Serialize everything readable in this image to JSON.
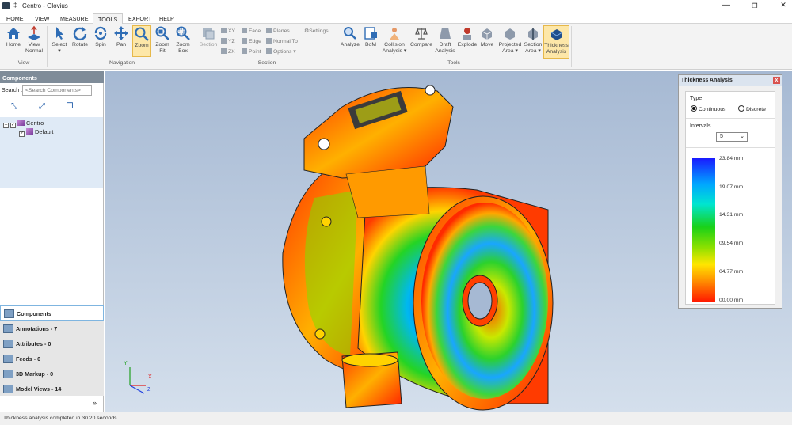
{
  "window": {
    "title": "Centro - Glovius",
    "pin": "‡",
    "min": "—",
    "max": "❐",
    "close": "✕"
  },
  "menu": {
    "tabs": [
      {
        "label": "HOME"
      },
      {
        "label": "VIEW"
      },
      {
        "label": "MEASURE"
      },
      {
        "label": "TOOLS"
      },
      {
        "label": "EXPORT"
      },
      {
        "label": "HELP"
      }
    ],
    "active": "TOOLS"
  },
  "ribbon": {
    "view": {
      "home": "Home",
      "view_normal_1": "View",
      "view_normal_2": "Normal",
      "group": "View"
    },
    "navigation": {
      "select": "Select",
      "rotate": "Rotate",
      "spin": "Spin",
      "pan": "Pan",
      "zoom": "Zoom",
      "zoom_fit_1": "Zoom",
      "zoom_fit_2": "Fit",
      "zoom_box_1": "Zoom",
      "zoom_box_2": "Box",
      "group": "Navigation"
    },
    "section": {
      "section": "Section",
      "xy": "XY",
      "yz": "YZ",
      "zx": "ZX",
      "face": "Face",
      "edge": "Edge",
      "point": "Point",
      "planes": "Planes",
      "normal_to": "Normal To",
      "options": "Options ▾",
      "settings": "Settings",
      "group": "Section"
    },
    "tools": {
      "analyze": "Analyze",
      "bom": "BoM",
      "collision_1": "Collision",
      "collision_2": "Analysis ▾",
      "compare": "Compare",
      "draft_1": "Draft",
      "draft_2": "Analysis",
      "explode": "Explode",
      "move": "Move",
      "projected_1": "Projected",
      "projected_2": "Area ▾",
      "section_area_1": "Section",
      "section_area_2": "Area ▾",
      "thickness_1": "Thickness",
      "thickness_2": "Analysis",
      "group": "Tools"
    }
  },
  "components_panel": {
    "header": "Components",
    "search_label": "Search :",
    "search_placeholder": "<Search Components>",
    "tree": [
      {
        "label": "Centro"
      },
      {
        "label": "Default"
      }
    ]
  },
  "bottom_tabs": [
    {
      "label": "Components"
    },
    {
      "label": "Annotations - 7"
    },
    {
      "label": "Attributes - 0"
    },
    {
      "label": "Feeds - 0"
    },
    {
      "label": "3D Markup - 0"
    },
    {
      "label": "Model Views - 14"
    }
  ],
  "collapse": "»",
  "axes": {
    "x": "X",
    "y": "Y",
    "z": "Z"
  },
  "thickness": {
    "header": "Thickness Analysis",
    "close": "x",
    "type_label": "Type",
    "continuous": "Continuous",
    "discrete": "Discrete",
    "selected_type": "Continuous",
    "intervals_label": "Intervals",
    "intervals_value": "5",
    "legend": [
      "23.84  mm",
      "19.07  mm",
      "14.31  mm",
      "09.54  mm",
      "04.77  mm",
      "00.00  mm"
    ]
  },
  "status": "Thickness analysis completed  in 30.20 seconds"
}
